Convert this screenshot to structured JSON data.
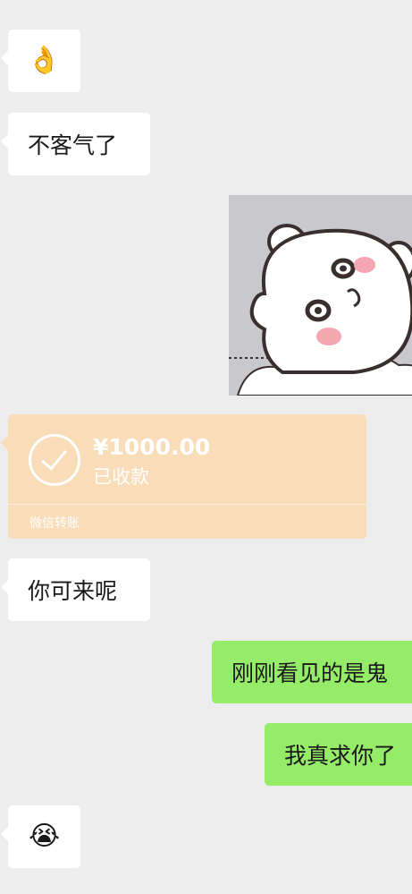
{
  "messages": [
    {
      "side": "left",
      "type": "emoji",
      "emoji": "👌",
      "icon": "ok-hand-emoji"
    },
    {
      "side": "left",
      "type": "text",
      "text": "不客气了"
    },
    {
      "side": "right",
      "type": "sticker",
      "icon": "white-bear-sticker"
    },
    {
      "side": "left",
      "type": "transfer",
      "amount": "¥1000.00",
      "status": "已收款",
      "footer": "微信转账"
    },
    {
      "side": "left",
      "type": "text",
      "text": "你可来呢"
    },
    {
      "side": "right",
      "type": "text",
      "text": "刚刚看见的是鬼"
    },
    {
      "side": "right",
      "type": "text",
      "text": "我真求你了"
    },
    {
      "side": "left",
      "type": "emoji",
      "emoji": "😭",
      "icon": "crying-laughing-emoji"
    }
  ],
  "colors": {
    "background": "#ededed",
    "left_bubble": "#ffffff",
    "right_bubble": "#95ec69",
    "transfer_card": "#f9ddb8"
  }
}
